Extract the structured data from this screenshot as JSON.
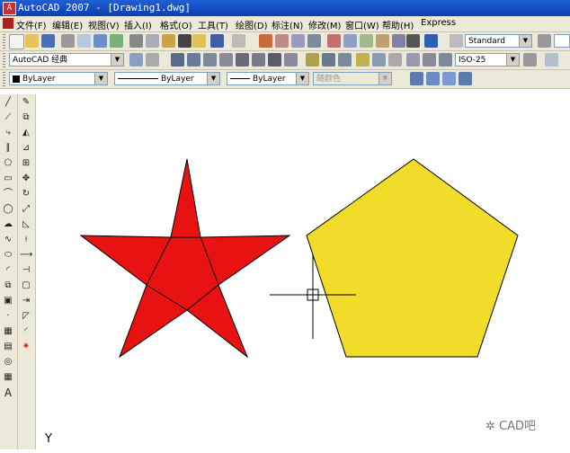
{
  "window": {
    "title": "AutoCAD 2007 - [Drawing1.dwg]",
    "app_icon_letter": "A"
  },
  "menu": {
    "items": [
      "文件(F)",
      "编辑(E)",
      "视图(V)",
      "插入(I)",
      "格式(O)",
      "工具(T)",
      "绘图(D)",
      "标注(N)",
      "修改(M)",
      "窗口(W)",
      "帮助(H)",
      "Express"
    ]
  },
  "toolbar": {
    "text_style": "Standard",
    "workspace": "AutoCAD 经典",
    "dim_style": "ISO-25",
    "layer_color": "ByLayer",
    "layer_linetype": "ByLayer",
    "layer_lineweight": "ByLayer",
    "plot_style": "随颜色"
  },
  "left_toolbar": {
    "text_tool_label": "A"
  },
  "canvas": {
    "ucs_y_label": "Y",
    "watermark_text": "CAD吧"
  },
  "colors": {
    "star_fill": "#e81212",
    "pentagon_fill": "#f2dc2a",
    "title_bar": "#0a3fb0"
  }
}
